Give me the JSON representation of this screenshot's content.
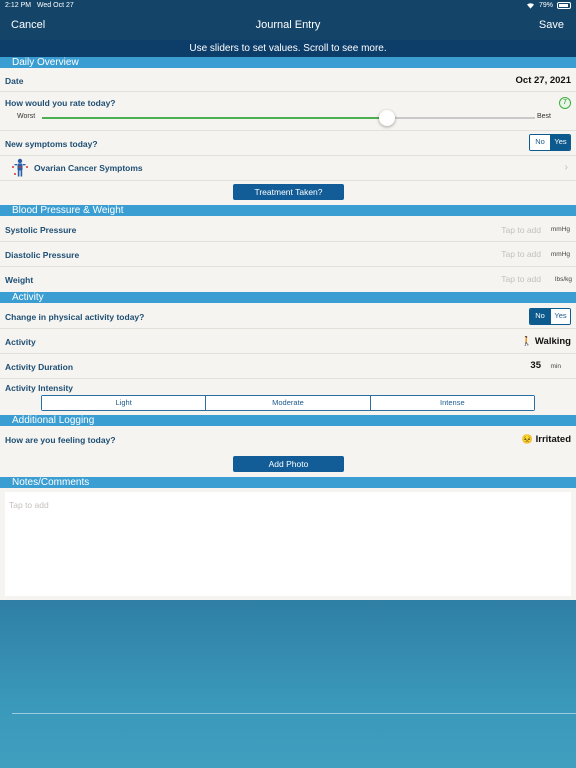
{
  "status": {
    "time": "2:12 PM",
    "date": "Wed Oct 27",
    "battery": "79%"
  },
  "nav": {
    "cancel": "Cancel",
    "title": "Journal Entry",
    "save": "Save"
  },
  "hint": "Use sliders to set values. Scroll to see more.",
  "sections": {
    "daily": "Daily Overview",
    "bp": "Blood Pressure & Weight",
    "activity": "Activity",
    "additional": "Additional Logging",
    "notes": "Notes/Comments"
  },
  "daily": {
    "date_label": "Date",
    "date_value": "Oct 27, 2021",
    "rate_label": "How would you rate today?",
    "rate_value": "7",
    "rate_fraction": 0.7,
    "worst": "Worst",
    "best": "Best",
    "symptoms_label": "New symptoms today?",
    "no": "No",
    "yes": "Yes",
    "cancer_symptoms": "Ovarian Cancer Symptoms",
    "treatment_button": "Treatment Taken?"
  },
  "bp": {
    "systolic_label": "Systolic Pressure",
    "diastolic_label": "Diastolic Pressure",
    "weight_label": "Weight",
    "placeholder": "Tap to add",
    "mmhg": "mmHg",
    "weight_unit": "lbs/kg"
  },
  "activity": {
    "change_label": "Change in physical activity today?",
    "no": "No",
    "yes": "Yes",
    "activity_label": "Activity",
    "activity_value": "Walking",
    "activity_icon": "🚶",
    "duration_label": "Activity Duration",
    "duration_value": "35",
    "duration_unit": "min",
    "intensity_label": "Activity Intensity",
    "intensity_options": [
      "Light",
      "Moderate",
      "Intense"
    ]
  },
  "additional": {
    "feeling_label": "How are you feeling today?",
    "feeling_value": "Irritated",
    "feeling_icon": "😣",
    "photo_button": "Add Photo"
  },
  "notes": {
    "placeholder": "Tap to add"
  },
  "colors": {
    "nav": "#144569",
    "hint": "#0d3e6a",
    "section": "#3b9ed2",
    "button": "#125d97",
    "label": "#1d4e74",
    "slider_fill": "#4caf50"
  }
}
